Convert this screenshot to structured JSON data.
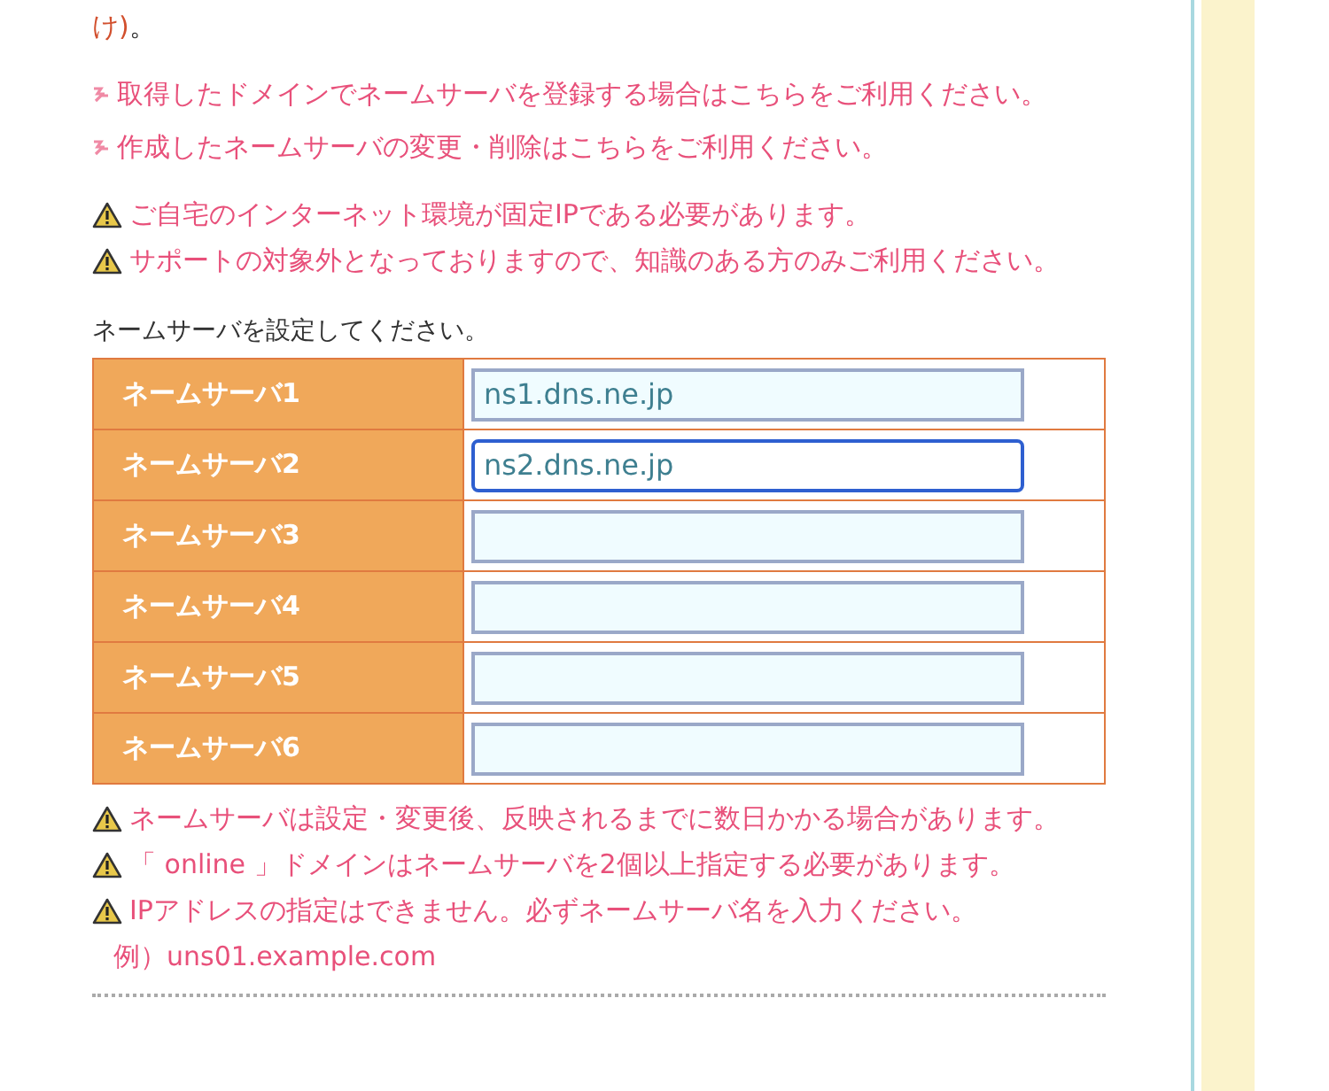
{
  "intro_tail": {
    "link": "け)",
    "punct": "。"
  },
  "links": [
    "取得したドメインでネームサーバを登録する場合はこちらをご利用ください。",
    "作成したネームサーバの変更・削除はこちらをご利用ください。"
  ],
  "notices": [
    "ご自宅のインターネット環境が固定IPである必要があります。",
    "サポートの対象外となっておりますので、知識のある方のみご利用ください。"
  ],
  "form_label": "ネームサーバを設定してください。",
  "nameservers": [
    {
      "label": "ネームサーバ1",
      "value": "ns1.dns.ne.jp",
      "focused": false
    },
    {
      "label": "ネームサーバ2",
      "value": "ns2.dns.ne.jp",
      "focused": true
    },
    {
      "label": "ネームサーバ3",
      "focused": false
    },
    {
      "label": "ネームサーバ4",
      "focused": false
    },
    {
      "label": "ネームサーバ5",
      "focused": false
    },
    {
      "label": "ネームサーバ6",
      "focused": false
    }
  ],
  "footnotes": [
    "ネームサーバは設定・変更後、反映されるまでに数日かかる場合があります。",
    "「 online 」ドメインはネームサーバを2個以上指定する必要があります。",
    "IPアドレスの指定はできません。必ずネームサーバ名を入力ください。"
  ],
  "example": "例）uns01.example.com"
}
